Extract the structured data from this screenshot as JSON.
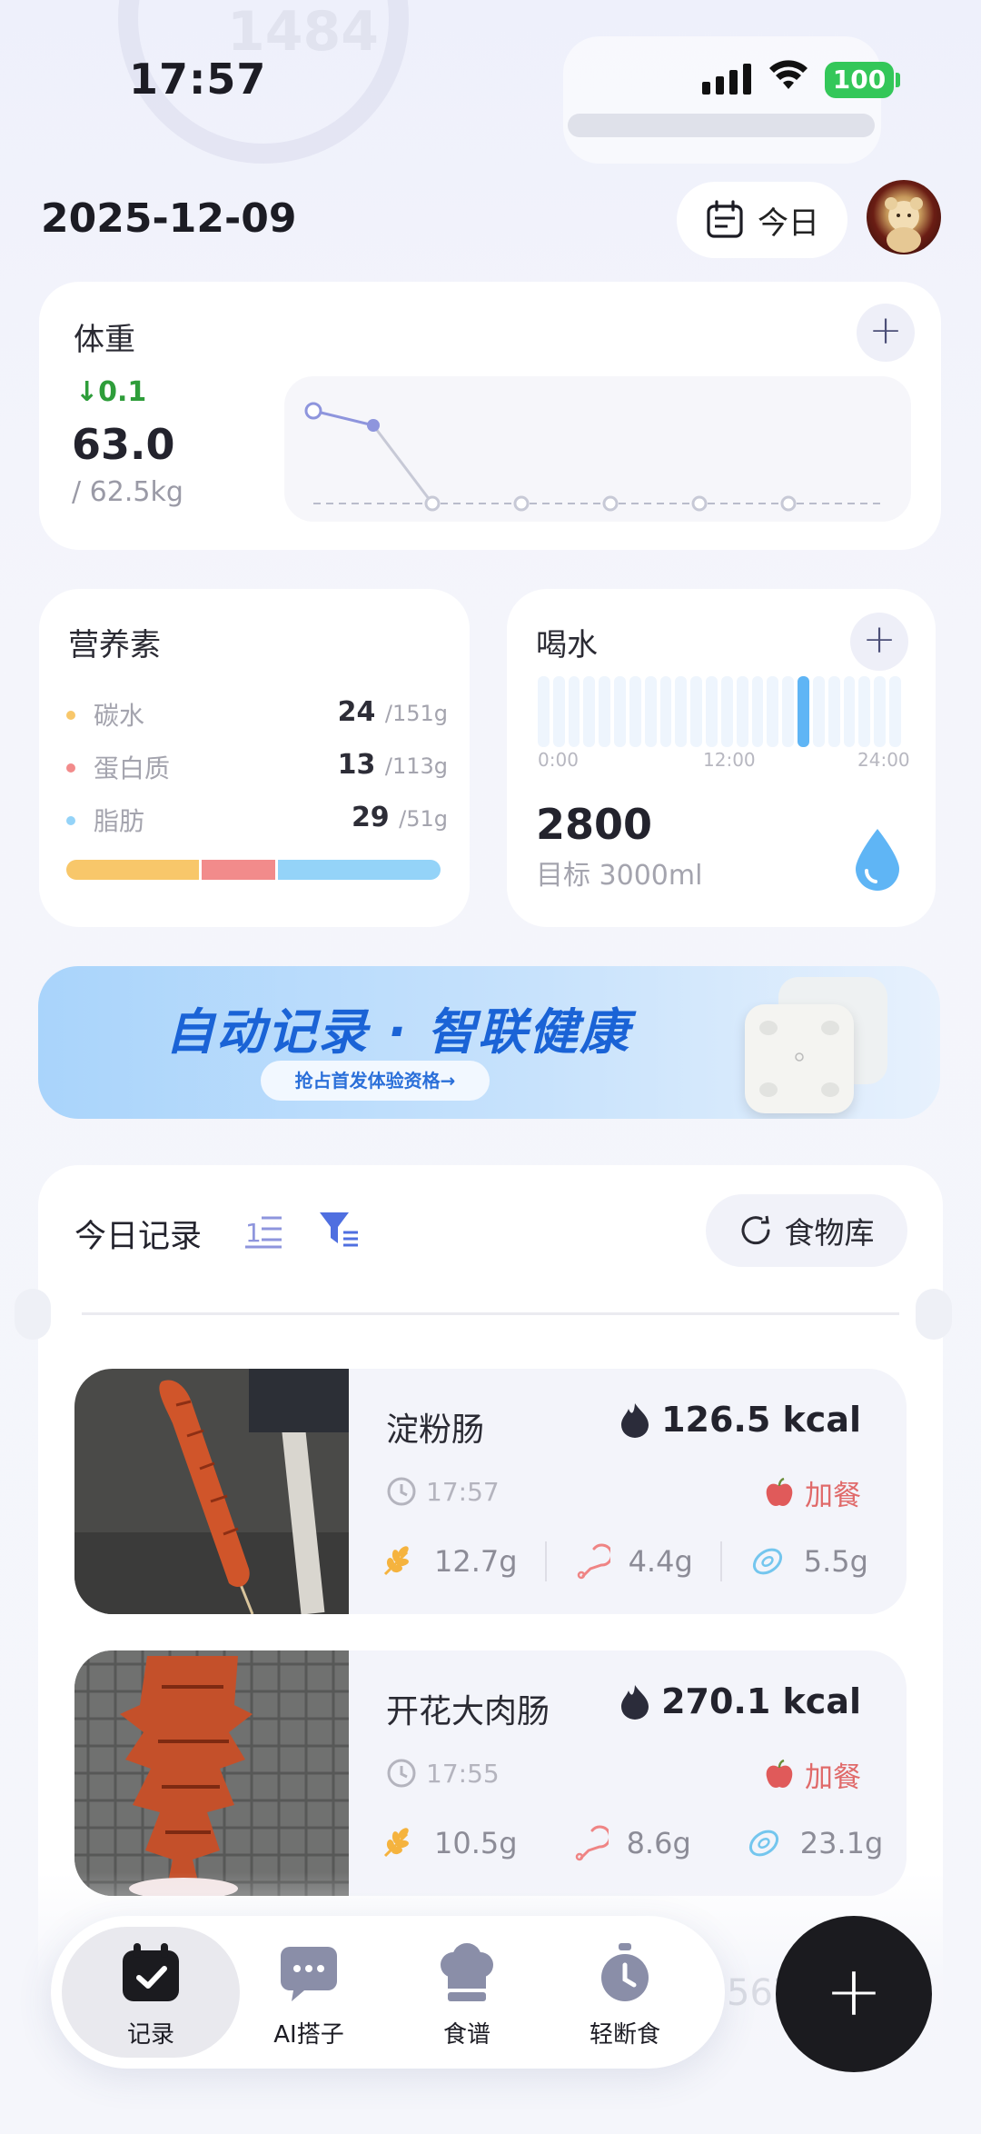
{
  "status": {
    "time": "17:57",
    "battery": "100"
  },
  "header": {
    "date": "2025-12-09",
    "today_label": "今日"
  },
  "weight": {
    "title": "体重",
    "delta": "0.1",
    "value": "63.0",
    "target": "/ 62.5kg",
    "trend": [
      {
        "label": "1",
        "value": 63.2
      },
      {
        "label": "2",
        "value": 63.0
      }
    ]
  },
  "nutrients": {
    "title": "营养素",
    "items": [
      {
        "name": "碳水",
        "value": "24",
        "goal": "/151g",
        "color": "#f8c76a"
      },
      {
        "name": "蛋白质",
        "value": "13",
        "goal": "/113g",
        "color": "#f28b8b"
      },
      {
        "name": "脂肪",
        "value": "29",
        "goal": "/51g",
        "color": "#94d3f8"
      }
    ],
    "bar_share": [
      0.36,
      0.2,
      0.44
    ]
  },
  "water": {
    "title": "喝水",
    "axis": [
      "0:00",
      "12:00",
      "24:00"
    ],
    "value": "2800",
    "goal": "目标 3000ml",
    "accent": "#5fb5f5"
  },
  "banner": {
    "title": "自动记录 · 智联健康",
    "cta": "抢占首发体验资格→"
  },
  "records": {
    "title": "今日记录",
    "food_library": "食物库",
    "items": [
      {
        "name": "淀粉肠",
        "kcal": "126.5 kcal",
        "time": "17:57",
        "meal": "加餐",
        "carb": "12.7g",
        "protein": "4.4g",
        "fat": "5.5g"
      },
      {
        "name": "开花大肉肠",
        "kcal": "270.1 kcal",
        "time": "17:55",
        "meal": "加餐",
        "carb": "10.5g",
        "protein": "8.6g",
        "fat": "23.1g"
      }
    ]
  },
  "nav": {
    "items": [
      {
        "label": "记录",
        "icon": "calendar-check-icon"
      },
      {
        "label": "AI搭子",
        "icon": "chat-bubble-icon"
      },
      {
        "label": "食谱",
        "icon": "chef-hat-icon"
      },
      {
        "label": "轻断食",
        "icon": "stopwatch-icon"
      }
    ],
    "fab": "+"
  }
}
